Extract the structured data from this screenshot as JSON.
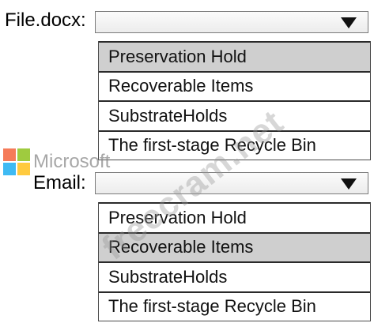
{
  "file_field": {
    "label": "File.docx:",
    "selected": "Preservation Hold",
    "options": [
      "Preservation Hold",
      "Recoverable Items",
      "SubstrateHolds",
      "The first-stage Recycle Bin"
    ]
  },
  "email_field": {
    "label": "Email:",
    "selected": "Recoverable Items",
    "options": [
      "Preservation Hold",
      "Recoverable Items",
      "SubstrateHolds",
      "The first-stage Recycle Bin"
    ]
  },
  "logo": {
    "text": "Microsoft",
    "colors": [
      "#f25022",
      "#7fba00",
      "#00a4ef",
      "#ffb900"
    ]
  },
  "watermark": {
    "text": "freecram.net"
  },
  "icons": {
    "dropdown_arrow": "triangle-down-icon"
  }
}
